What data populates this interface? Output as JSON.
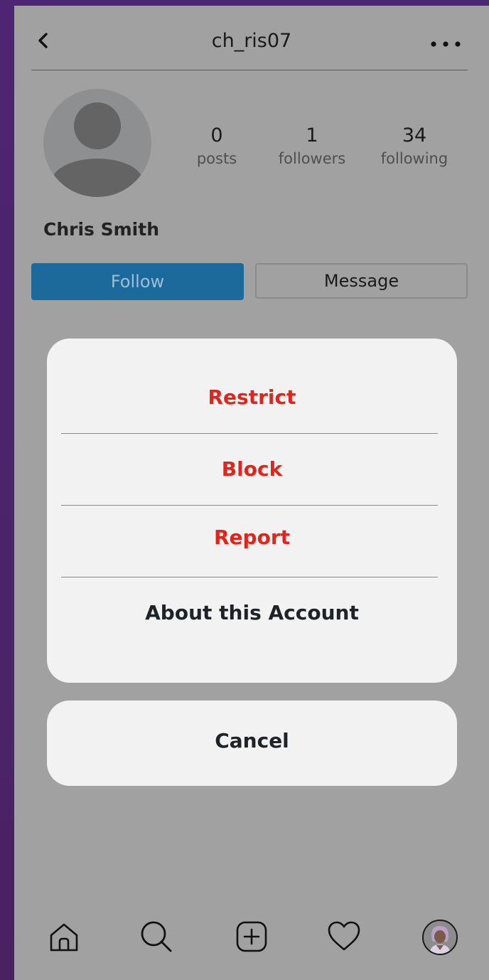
{
  "header": {
    "username": "ch_ris07",
    "back_icon": "chevron-left-icon",
    "more_icon": "more-horizontal-icon"
  },
  "profile": {
    "display_name": "Chris Smith",
    "avatar_icon": "default-avatar-icon",
    "stats": [
      {
        "value": "0",
        "label": "posts"
      },
      {
        "value": "1",
        "label": "followers"
      },
      {
        "value": "34",
        "label": "following"
      }
    ]
  },
  "actions": {
    "follow_label": "Follow",
    "message_label": "Message"
  },
  "sheet": {
    "items": [
      {
        "label": "Restrict",
        "color": "#e0261c"
      },
      {
        "label": "Block",
        "color": "#e0261c"
      },
      {
        "label": "Report",
        "color": "#e0261c"
      },
      {
        "label": "About this Account",
        "color": "#1f2327"
      }
    ],
    "cancel_label": "Cancel"
  },
  "bottom_nav": {
    "items": [
      "home-icon",
      "search-icon",
      "add-post-icon",
      "heart-icon",
      "profile-avatar-icon"
    ]
  },
  "colors": {
    "overlay": "#a1a1a1",
    "follow_button": "#1c6a9c",
    "sheet_bg": "#f2f2f2",
    "danger": "#e0261c",
    "frame": "#4d2572"
  }
}
